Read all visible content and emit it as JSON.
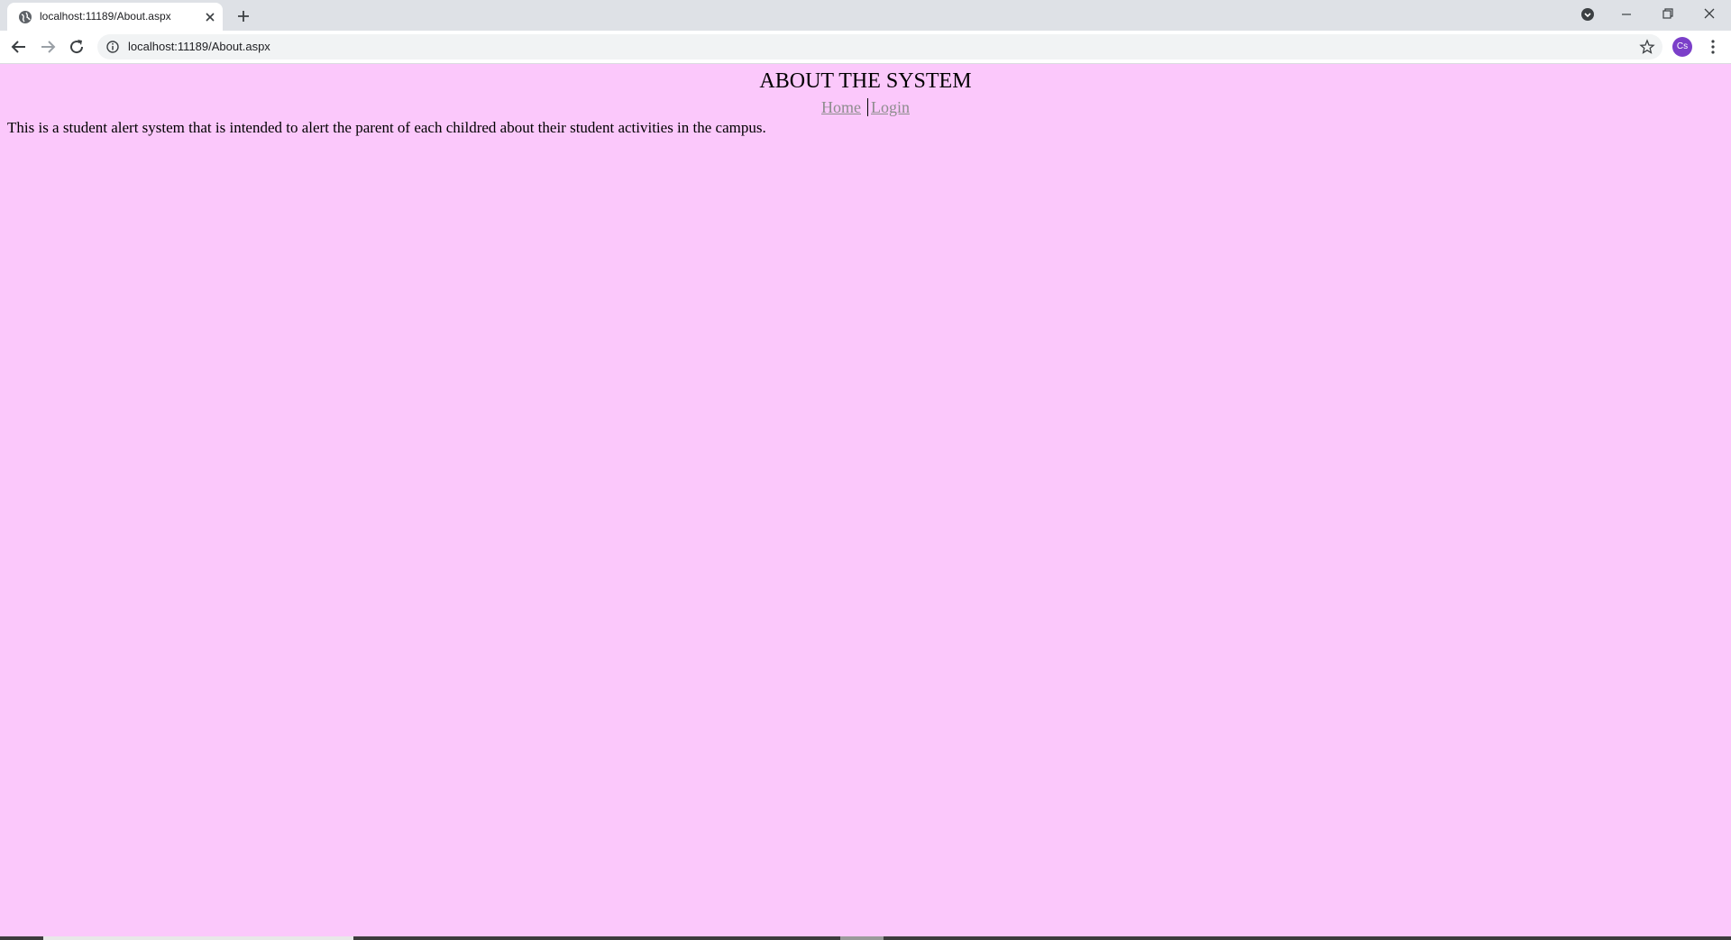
{
  "browser": {
    "tab_title": "localhost:11189/About.aspx",
    "url": "localhost:11189/About.aspx",
    "profile_initials": "Cs"
  },
  "page": {
    "heading": "ABOUT THE SYSTEM",
    "nav": {
      "home": "Home",
      "login": "Login"
    },
    "body": "This is a student alert system that is intended to alert the parent of each childred about their student activities in the campus.",
    "background": "#fbc8fb",
    "link_color": "#8d8d8d"
  }
}
